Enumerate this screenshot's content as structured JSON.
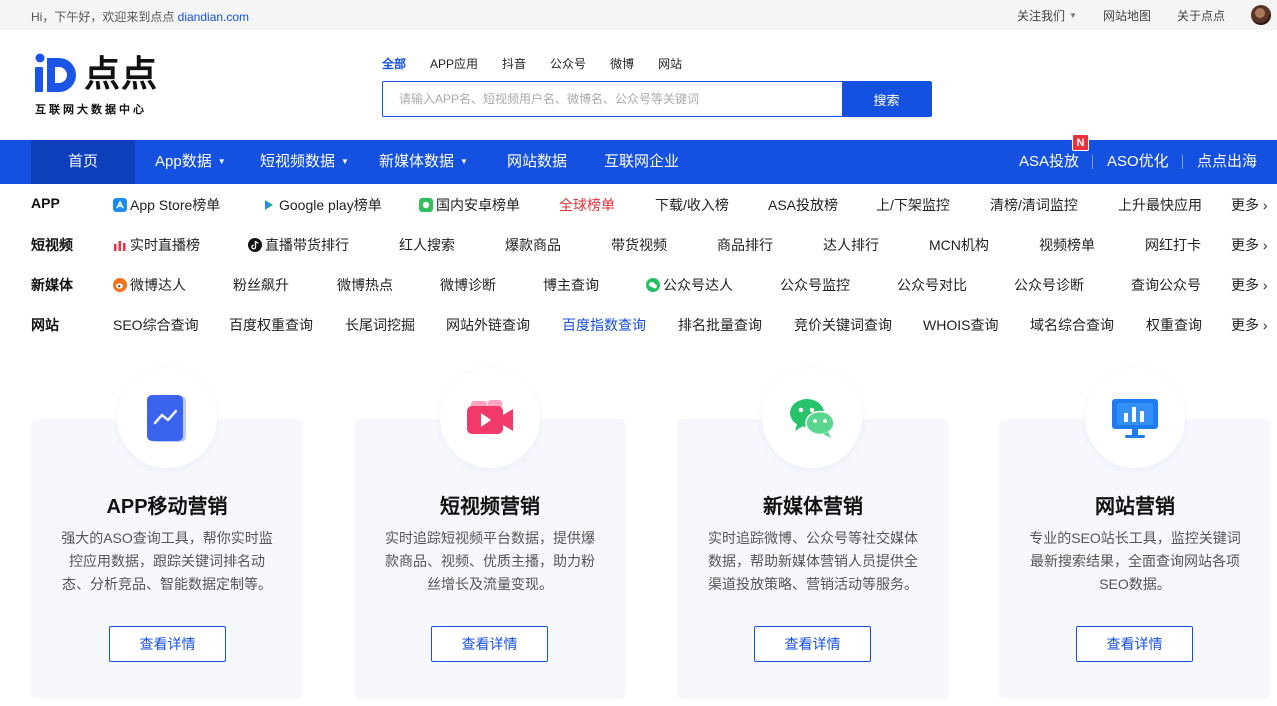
{
  "topbar": {
    "greeting": "Hi，下午好，欢迎来到点点 ",
    "site": "diandian.com",
    "links": [
      "关注我们",
      "网站地图",
      "关于点点"
    ]
  },
  "logo": {
    "name": "点点",
    "subtitle": "互联网大数据中心"
  },
  "search": {
    "tabs": [
      "全部",
      "APP应用",
      "抖音",
      "公众号",
      "微博",
      "网站"
    ],
    "active_tab": "全部",
    "placeholder": "请输入APP名、短视频用户名、微博名、公众号等关键词",
    "button": "搜索"
  },
  "nav": {
    "left": [
      {
        "label": "首页",
        "dropdown": false
      },
      {
        "label": "App数据",
        "dropdown": true
      },
      {
        "label": "短视频数据",
        "dropdown": true
      },
      {
        "label": "新媒体数据",
        "dropdown": true
      },
      {
        "label": "网站数据",
        "dropdown": false
      },
      {
        "label": "互联网企业",
        "dropdown": false
      }
    ],
    "right": [
      "ASA投放",
      "ASO优化",
      "点点出海"
    ],
    "badge": "N"
  },
  "quick_rows": [
    {
      "category": "APP",
      "links": [
        "App Store榜单",
        "Google play榜单",
        "国内安卓榜单",
        "全球榜单",
        "下载/收入榜",
        "ASA投放榜",
        "上/下架监控",
        "清榜/清词监控",
        "上升最快应用"
      ],
      "more": "更多"
    },
    {
      "category": "短视频",
      "links": [
        "实时直播榜",
        "直播带货排行",
        "红人搜索",
        "爆款商品",
        "带货视频",
        "商品排行",
        "达人排行",
        "MCN机构",
        "视频榜单",
        "网红打卡"
      ],
      "more": "更多"
    },
    {
      "category": "新媒体",
      "links": [
        "微博达人",
        "粉丝飙升",
        "微博热点",
        "微博诊断",
        "博主查询",
        "公众号达人",
        "公众号监控",
        "公众号对比",
        "公众号诊断",
        "查询公众号"
      ],
      "more": "更多"
    },
    {
      "category": "网站",
      "links": [
        "SEO综合查询",
        "百度权重查询",
        "长尾词挖掘",
        "网站外链查询",
        "百度指数查询",
        "排名批量查询",
        "竞价关键词查询",
        "WHOIS查询",
        "域名综合查询",
        "权重查询"
      ],
      "more": "更多"
    }
  ],
  "cards": [
    {
      "title": "APP移动营销",
      "desc": "强大的ASO查询工具，帮你实时监控应用数据，跟踪关键词排名动态、分析竞品、智能数据定制等。",
      "button": "查看详情",
      "icon": "phone-chart-icon"
    },
    {
      "title": "短视频营销",
      "desc": "实时追踪短视频平台数据，提供爆款商品、视频、优质主播，助力粉丝增长及流量变现。",
      "button": "查看详情",
      "icon": "video-camera-icon"
    },
    {
      "title": "新媒体营销",
      "desc": "实时追踪微博、公众号等社交媒体数据，帮助新媒体营销人员提供全渠道投放策略、营销活动等服务。",
      "button": "查看详情",
      "icon": "wechat-icon"
    },
    {
      "title": "网站营销",
      "desc": "专业的SEO站长工具，监控关键词最新搜索结果，全面查询网站各项SEO数据。",
      "button": "查看详情",
      "icon": "monitor-chart-icon"
    }
  ],
  "colors": {
    "brand": "#1551e0",
    "nav_active": "#0d3fba",
    "highlight_red": "#e8323c",
    "card_bg": "#f6f8fd"
  }
}
